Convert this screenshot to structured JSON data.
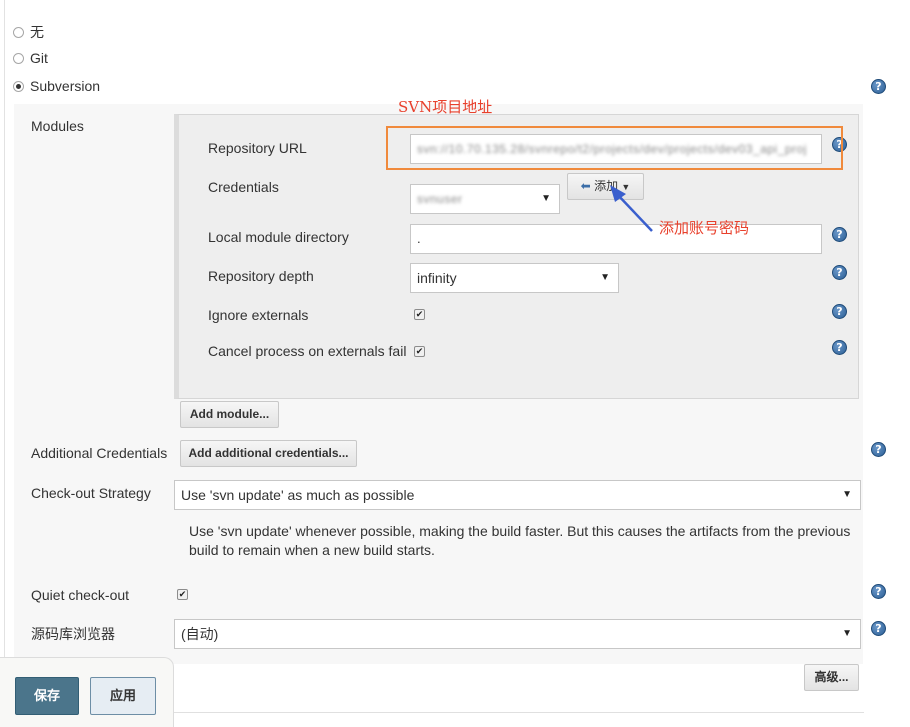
{
  "scm": {
    "options": [
      {
        "label": "无",
        "selected": false
      },
      {
        "label": "Git",
        "selected": false
      },
      {
        "label": "Subversion",
        "selected": true
      }
    ]
  },
  "modules": {
    "label": "Modules",
    "repository_url_label": "Repository URL",
    "repository_url_value": "svn://10.70.135.28/svnrepo/t2/projects/dev/projects/dev03_api_proj",
    "credentials_label": "Credentials",
    "credentials_value": "svnuser",
    "add_button_label": "添加",
    "local_dir_label": "Local module directory",
    "local_dir_value": ".",
    "depth_label": "Repository depth",
    "depth_value": "infinity",
    "ignore_externals_label": "Ignore externals",
    "ignore_externals_checked": true,
    "cancel_externals_label": "Cancel process on externals fail",
    "cancel_externals_checked": true,
    "add_module_label": "Add module..."
  },
  "additional_credentials": {
    "label": "Additional Credentials",
    "button_label": "Add additional credentials..."
  },
  "checkout_strategy": {
    "label": "Check-out Strategy",
    "value": "Use 'svn update' as much as possible",
    "description": "Use 'svn update' whenever possible, making the build faster. But this causes the artifacts from the previous build to remain when a new build starts."
  },
  "quiet_checkout": {
    "label": "Quiet check-out",
    "checked": true
  },
  "repo_browser": {
    "label": "源码库浏览器",
    "value": "(自动)"
  },
  "advanced_label": "高级...",
  "footer": {
    "save_label": "保存",
    "apply_label": "应用"
  },
  "annotations": {
    "svn_url": "SVN项目地址",
    "add_account": "添加账号密码",
    "highlight_color": "#f08a3c",
    "annotation_text_color": "#e8402c",
    "arrow_color": "#3a5fcd"
  },
  "icons": {
    "help": "help-icon",
    "dropdown": "caret-down-icon",
    "add": "arrow-left-icon"
  }
}
